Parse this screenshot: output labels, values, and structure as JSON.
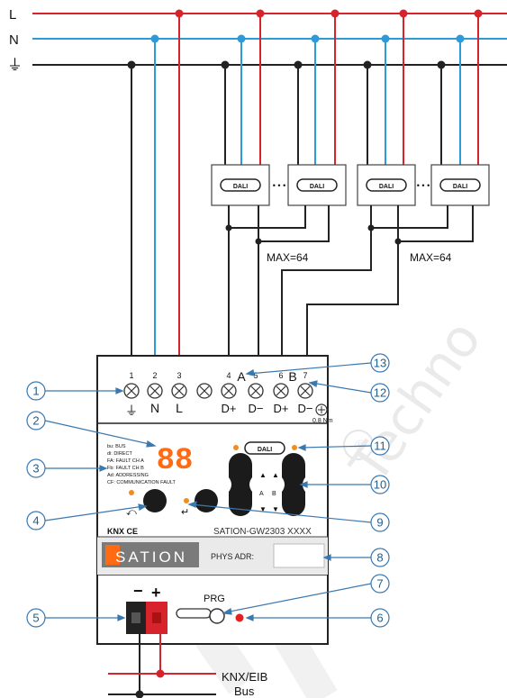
{
  "bus_lines": {
    "line": "L",
    "neutral": "N",
    "earth_symbol": "⏚"
  },
  "dali_ballast_label": "DALI",
  "ellipsis": "• • •",
  "max_note_a": "MAX=64",
  "max_note_b": "MAX=64",
  "terminals": {
    "numbers": [
      "1",
      "2",
      "3",
      "4",
      "5",
      "6",
      "7"
    ],
    "bottom_labels": [
      "N",
      "L",
      "D+",
      "D−",
      "D+",
      "D−"
    ],
    "earth": "⏚",
    "channel_a": "A",
    "channel_b": "B",
    "torque": "0.8 Nm"
  },
  "display": {
    "digits": "88",
    "legend": [
      "bu: BUS",
      "di: DIRECT",
      "FA: FAULT CH A",
      "Fb: FAULT CH B",
      "Ad: ADDRESSING",
      "CF: COMMUNICATION FAULT"
    ]
  },
  "keypad": {
    "up_arrow": "▲",
    "down_arrow": "▼",
    "a": "A",
    "b": "B",
    "back_symbol": "⤺",
    "enter_symbol": "↵",
    "dali_badge": "DALI"
  },
  "branding": {
    "knx_ce": "KNX CE",
    "model": "SATION-GW2303 XXXX",
    "logo": "SATION",
    "phys_adr": "PHYS ADR:"
  },
  "prg_label": "PRG",
  "minus": "−",
  "plus": "+",
  "knx_bus": {
    "line1": "KNX/EIB",
    "line2": "Bus"
  },
  "callouts": [
    "1",
    "2",
    "3",
    "4",
    "5",
    "6",
    "7",
    "8",
    "9",
    "10",
    "11",
    "12",
    "13"
  ],
  "watermark": "® Techno",
  "colors": {
    "line_L": "#d7232b",
    "line_N": "#2f9ad8",
    "line_E": "#222222",
    "callout": "#3a78b0",
    "display": "#ff6a13",
    "led_orange": "#f28c1e",
    "led_red": "#e52020"
  }
}
